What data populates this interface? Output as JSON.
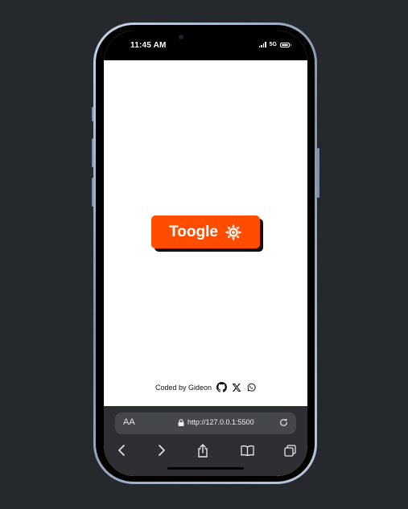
{
  "status_bar": {
    "time": "11:45 AM",
    "network": "5G"
  },
  "page": {
    "toggle_button_label": "Toogle",
    "toggle_icon": "sun-icon",
    "credit_text": "Coded by Gideon",
    "credit_icons": [
      "github-icon",
      "x-icon",
      "whatsapp-icon"
    ]
  },
  "browser": {
    "text_size_label": "AA",
    "url": "http://127.0.0.1:5500",
    "toolbar_icons": [
      "back-icon",
      "forward-icon",
      "share-icon",
      "bookmarks-icon",
      "tabs-icon"
    ]
  },
  "colors": {
    "background": "#25292e",
    "accent": "#ff4d00",
    "button_shadow": "#111111",
    "browser_chrome": "#2d2f33"
  }
}
